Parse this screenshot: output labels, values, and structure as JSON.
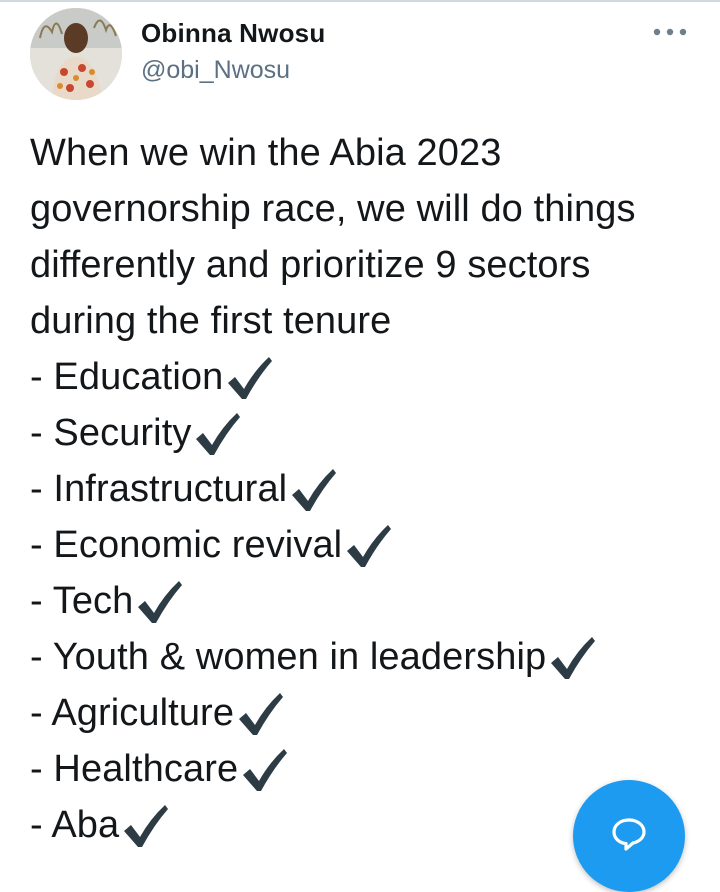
{
  "author": {
    "display_name": "Obinna Nwosu",
    "handle": "@obi_Nwosu"
  },
  "menu": {
    "icon": "more-dots-icon"
  },
  "tweet": {
    "intro": "When we win the Abia 2023 governorship race, we will do things differently and prioritize 9 sectors during the first tenure",
    "sectors": [
      "- Education",
      "- Security",
      "- Infrastructural",
      "- Economic revival",
      "- Tech",
      "- Youth & women in leadership",
      "- Agriculture",
      "- Healthcare",
      "- Aba"
    ],
    "check_icon": "check-mark-icon"
  },
  "fab": {
    "icon": "compose-bubble-icon",
    "color": "#1d9bf0"
  },
  "colors": {
    "text": "#14171a",
    "secondary": "#5b7083",
    "check": "#2c3b44"
  }
}
